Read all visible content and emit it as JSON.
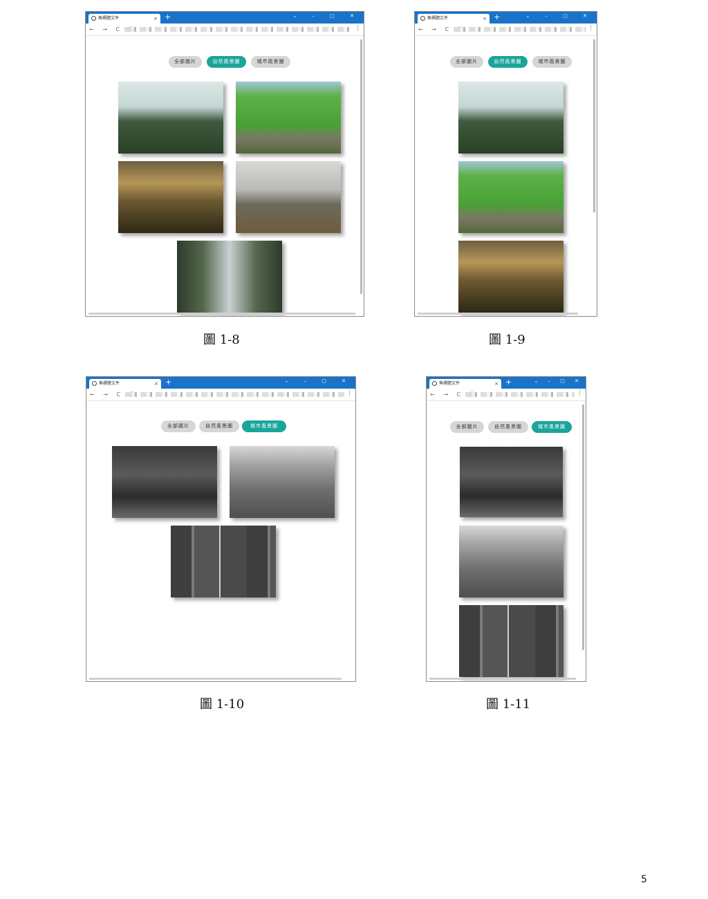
{
  "browser": {
    "tab_title": "無標題文件",
    "new_tab": "+",
    "close_tab": "×",
    "window_controls": "⌄ – ▢ ✕",
    "nav_glyphs": "← → C ⓘ",
    "menu_glyph": "⋮"
  },
  "filters": {
    "all": "全部圖片",
    "nature": "自然風景圖",
    "city": "城市風景圖"
  },
  "colors": {
    "active": "#1aa59a",
    "inactive": "#d6d6d6",
    "titlebar": "#1a73c8"
  },
  "captions": {
    "fig8": "圖 1-8",
    "fig9": "圖 1-9",
    "fig10": "圖 1-10",
    "fig11": "圖 1-11"
  },
  "page_number": "5"
}
